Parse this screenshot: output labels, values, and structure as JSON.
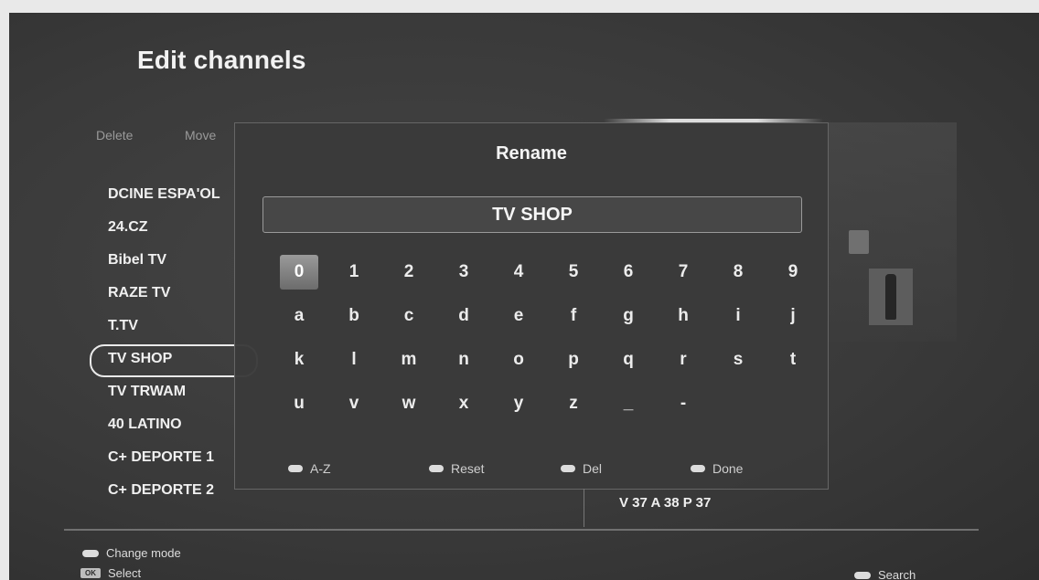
{
  "page_title": "Edit channels",
  "toolbar": {
    "delete_label": "Delete",
    "move_label": "Move"
  },
  "channels": [
    {
      "name": "DCINE ESPA'OL",
      "selected": false
    },
    {
      "name": "24.CZ",
      "selected": false
    },
    {
      "name": "Bibel TV",
      "selected": false
    },
    {
      "name": "RAZE TV",
      "selected": false
    },
    {
      "name": "T.TV",
      "selected": false
    },
    {
      "name": "TV SHOP",
      "selected": true
    },
    {
      "name": "TV TRWAM",
      "selected": false
    },
    {
      "name": "40 LATINO",
      "selected": false
    },
    {
      "name": "C+ DEPORTE 1",
      "selected": false
    },
    {
      "name": "C+ DEPORTE 2",
      "selected": false
    }
  ],
  "rename_dialog": {
    "title": "Rename",
    "field_value": "TV SHOP",
    "keyboard_rows": [
      [
        "0",
        "1",
        "2",
        "3",
        "4",
        "5",
        "6",
        "7",
        "8",
        "9"
      ],
      [
        "a",
        "b",
        "c",
        "d",
        "e",
        "f",
        "g",
        "h",
        "i",
        "j"
      ],
      [
        "k",
        "l",
        "m",
        "n",
        "o",
        "p",
        "q",
        "r",
        "s",
        "t"
      ],
      [
        "u",
        "v",
        "w",
        "x",
        "y",
        "z",
        "_",
        "-"
      ]
    ],
    "focused_key": "0",
    "hints": [
      {
        "label": "A-Z",
        "icon": "color-button-icon"
      },
      {
        "label": "Reset",
        "icon": "color-button-icon"
      },
      {
        "label": "Del",
        "icon": "color-button-icon"
      },
      {
        "label": "Done",
        "icon": "color-button-icon"
      }
    ]
  },
  "status": {
    "line": "V 37 A 38 P 37"
  },
  "footer": {
    "change_mode_label": "Change mode",
    "ok_badge": "OK",
    "select_label": "Select",
    "search_label": "Search"
  }
}
